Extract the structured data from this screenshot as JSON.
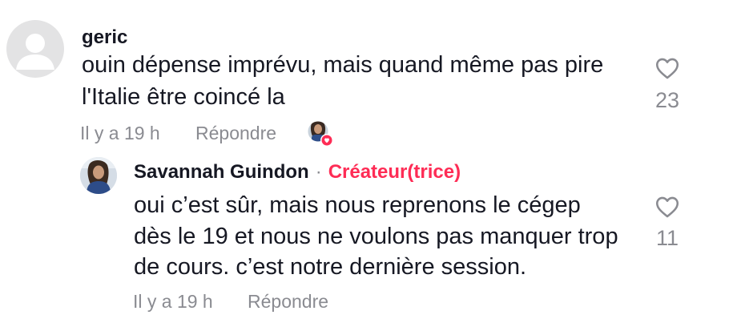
{
  "comment": {
    "username": "geric",
    "text_line1": "ouin dépense imprévu, mais quand même pas pire",
    "text_line2": "l'Italie être coincé la",
    "time": "Il y a 19 h",
    "reply_label": "Répondre",
    "likes": "23"
  },
  "reply": {
    "username": "Savannah Guindon",
    "separator": "·",
    "badge": "Créateur(trice)",
    "text_line1": "oui c’est sûr, mais nous reprenons le cégep",
    "text_line2": "dès le 19 et nous ne voulons pas manquer trop",
    "text_line3": "de cours. c’est notre dernière session.",
    "time": "Il y a 19 h",
    "reply_label": "Répondre",
    "likes": "11"
  },
  "colors": {
    "accent": "#fe2c55",
    "muted": "#8a8b91",
    "text": "#161823"
  },
  "icons": {
    "like": "heart-outline-icon",
    "creator_liked": "heart-filled-icon"
  }
}
